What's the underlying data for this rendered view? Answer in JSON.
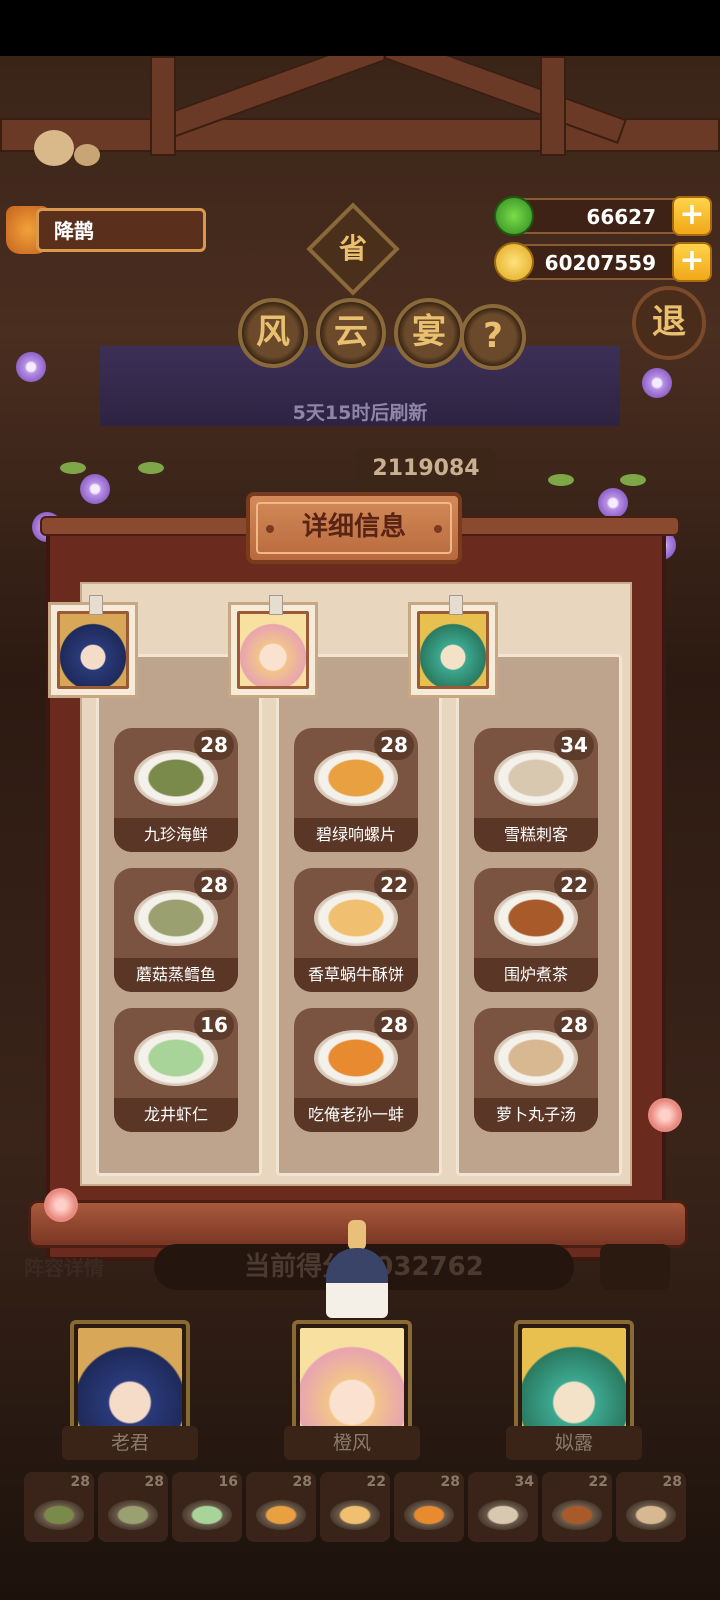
{
  "player": {
    "name": "降鹊"
  },
  "currency": {
    "jade": "66627",
    "coins": "60207559"
  },
  "title_chars": {
    "province": "省",
    "feng": "风",
    "yun": "云",
    "yan": "宴",
    "help": "?",
    "exit": "退"
  },
  "refresh_text": "5天15时后刷新",
  "top_score": "2119084",
  "modal": {
    "title": "详细信息",
    "columns": [
      {
        "dishes": [
          {
            "name": "九珍海鲜",
            "level": "28",
            "color": "#7a8a4a"
          },
          {
            "name": "蘑菇蒸鳕鱼",
            "level": "28",
            "color": "#9aa070"
          },
          {
            "name": "龙井虾仁",
            "level": "16",
            "color": "#a8d49a"
          }
        ]
      },
      {
        "dishes": [
          {
            "name": "碧绿响螺片",
            "level": "28",
            "color": "#e8a040"
          },
          {
            "name": "香草蜗牛酥饼",
            "level": "22",
            "color": "#f0c070"
          },
          {
            "name": "吃俺老孙一蚌",
            "level": "28",
            "color": "#e88a30"
          }
        ]
      },
      {
        "dishes": [
          {
            "name": "雪糕刺客",
            "level": "34",
            "color": "#d8c8b0"
          },
          {
            "name": "围炉煮茶",
            "level": "22",
            "color": "#a85a2a"
          },
          {
            "name": "萝卜丸子汤",
            "level": "28",
            "color": "#d8b890"
          }
        ]
      }
    ]
  },
  "lineup": {
    "label": "阵容详情",
    "score_text": "当前得分 2032762",
    "characters": [
      {
        "name": "老君"
      },
      {
        "name": "橙风"
      },
      {
        "name": "姒露"
      }
    ],
    "slots": [
      "28",
      "28",
      "16",
      "28",
      "22",
      "28",
      "34",
      "22",
      "28"
    ]
  }
}
